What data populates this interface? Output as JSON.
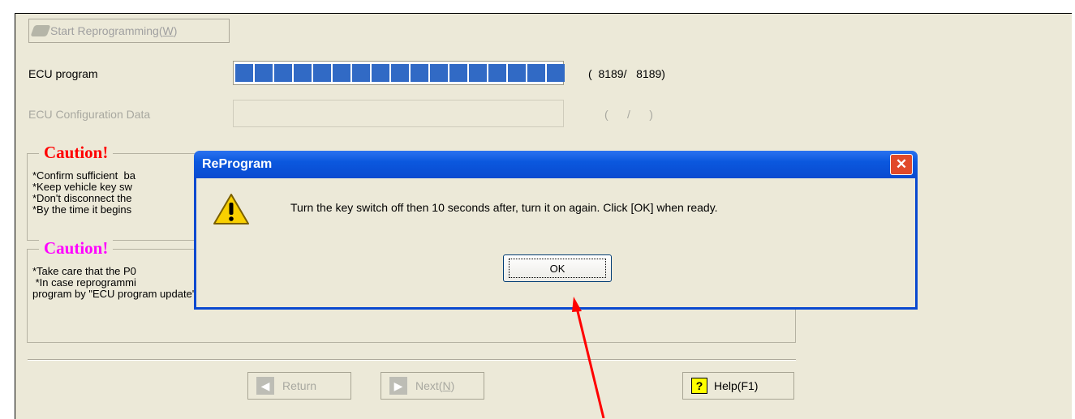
{
  "toolbar": {
    "start_label_pre": "Start Reprogramming(",
    "start_label_key": "W",
    "start_label_post": ")"
  },
  "rows": [
    {
      "label": "ECU program",
      "progress_fraction": 1.0,
      "count": "(  8189/   8189)"
    },
    {
      "label": "ECU Configuration Data",
      "progress_fraction": 0.0,
      "count": "(      /      )"
    }
  ],
  "caution1": {
    "title": "Caution!",
    "title_color": "#ff0000",
    "lines": [
      "*Confirm sufficient  ba",
      "*Keep vehicle key sw",
      "*Don't disconnect the",
      "*By the time it begins"
    ]
  },
  "caution2": {
    "title": "Caution!",
    "title_color": "#ff00ff",
    "lines": [
      "*Take care that the P0",
      " *In case reprogrammi",
      "program by \"ECU program update\"."
    ]
  },
  "footer": {
    "return_label": "Return",
    "next_label_pre": "Next(",
    "next_label_key": "N",
    "next_label_post": ")",
    "help_label": "Help(F1)",
    "help_icon": "question-icon"
  },
  "dialog": {
    "title": "ReProgram",
    "message": "Turn the key switch off then 10 seconds after, turn it on again. Click [OK] when ready.",
    "ok_label": "OK",
    "icon": "warning-icon",
    "close_glyph": "✕"
  },
  "annotation": {
    "color": "#ff0000"
  }
}
